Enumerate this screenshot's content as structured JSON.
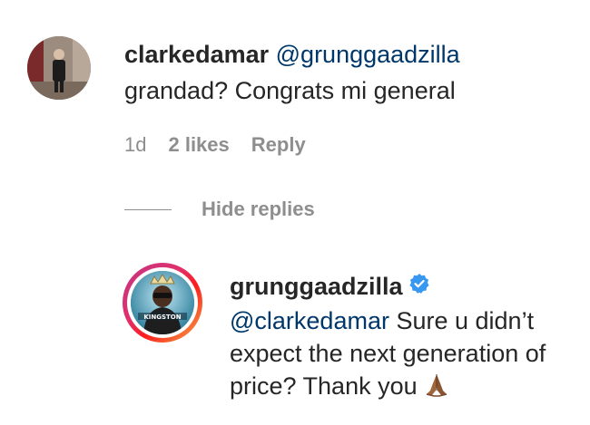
{
  "comment": {
    "username": "clarkedamar",
    "mention": "@grunggaadzilla",
    "text": "grandad? Congrats mi general",
    "time": "1d",
    "likes": "2 likes",
    "reply_label": "Reply",
    "avatar_icon": "user-avatar-photo"
  },
  "replies_toggle": {
    "label": "Hide replies"
  },
  "reply": {
    "username": "grunggaadzilla",
    "verified_icon": "verified-badge-icon",
    "mention": "@clarkedamar",
    "text": " Sure u didn’t expect the next generation of price? Thank you",
    "emoji_icon": "praying-hands-icon",
    "avatar_caption": "KINGSTON",
    "story_ring_colors": [
      "#c13584",
      "#e1306c",
      "#fd1d1d",
      "#f77737",
      "#fcaf45"
    ]
  },
  "colors": {
    "text": "#262626",
    "mention": "#00376b",
    "meta": "#8e8e8e",
    "verified": "#3897f0"
  }
}
